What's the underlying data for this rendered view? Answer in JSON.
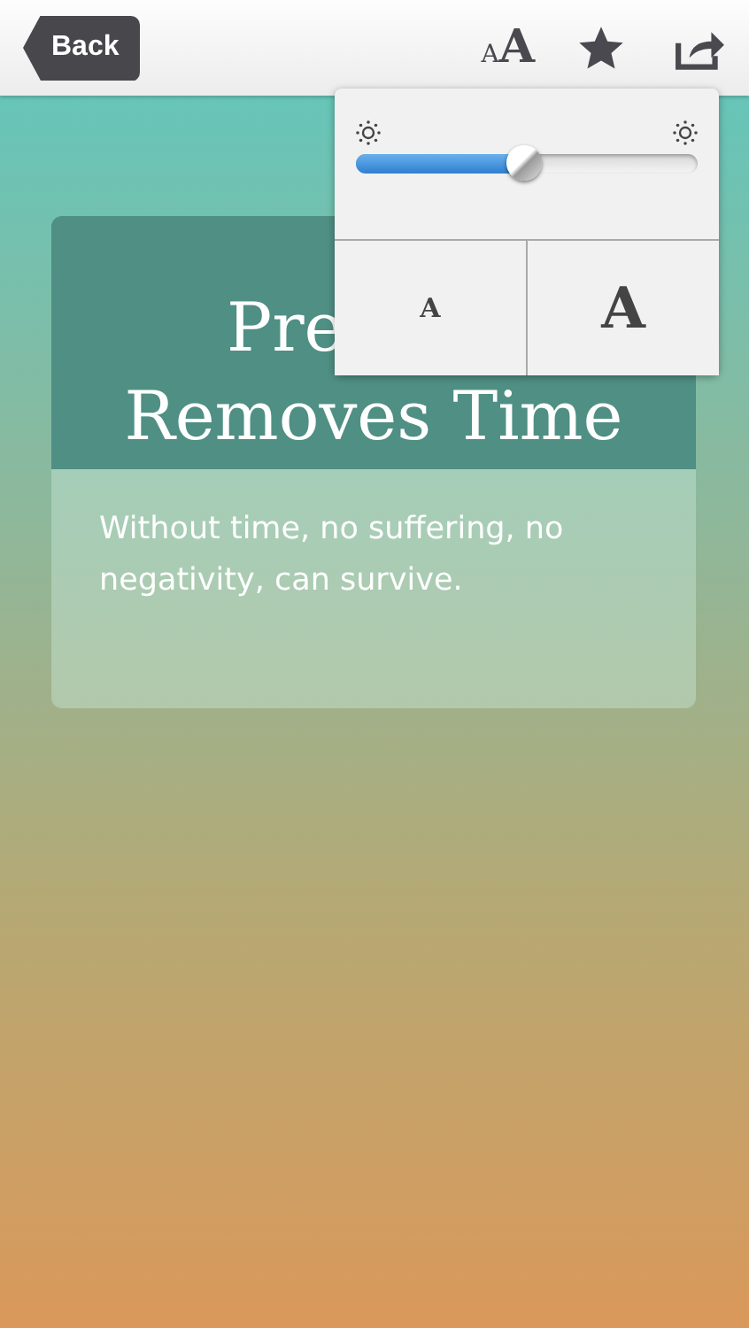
{
  "nav": {
    "back": "Back",
    "text_size": {
      "small": "A",
      "large": "A"
    }
  },
  "card": {
    "title_lines": [
      "Pre",
      "Removes Time"
    ],
    "body": "Without time, no suffering, no negativity, can survive."
  },
  "popover": {
    "brightness": {
      "level": 0.49
    },
    "font_buttons": [
      {
        "label": "A",
        "kind": "smaller"
      },
      {
        "label": "A",
        "kind": "larger"
      }
    ]
  }
}
